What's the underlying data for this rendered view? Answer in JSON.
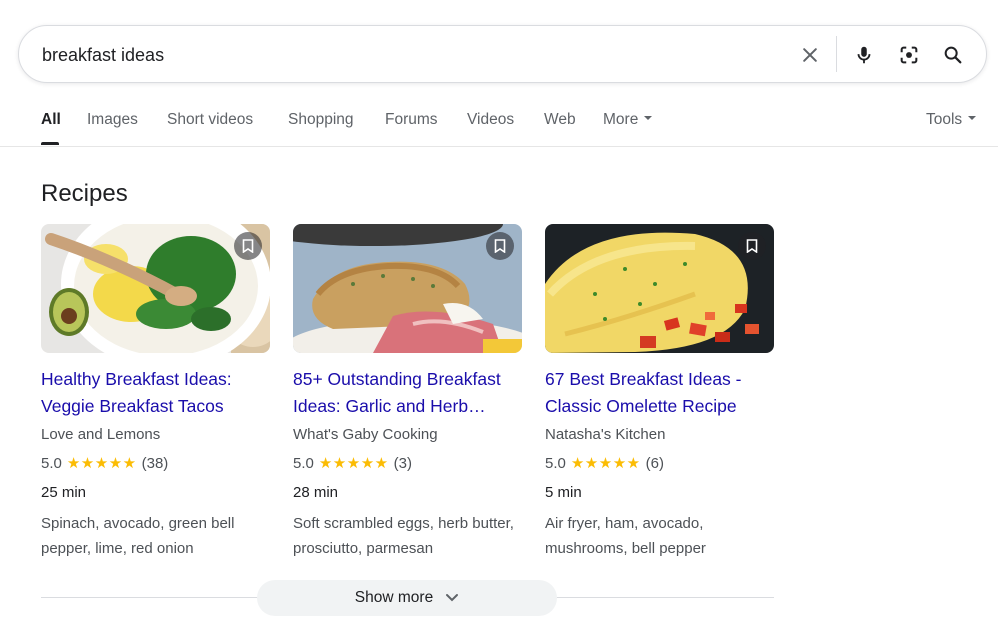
{
  "search": {
    "query": "breakfast ideas",
    "icons": [
      "close-icon",
      "microphone-icon",
      "lens-icon",
      "search-icon"
    ]
  },
  "tabs": [
    {
      "label": "All",
      "active": true
    },
    {
      "label": "Images"
    },
    {
      "label": "Short videos"
    },
    {
      "label": "Shopping"
    },
    {
      "label": "Forums"
    },
    {
      "label": "Videos"
    },
    {
      "label": "Web"
    },
    {
      "label": "More"
    }
  ],
  "tools_label": "Tools",
  "section": {
    "title": "Recipes"
  },
  "recipes": [
    {
      "title": "Healthy Breakfast Ideas: Veggie Breakfast Tacos",
      "source": "Love and Lemons",
      "rating": "5.0",
      "stars": "★★★★★",
      "reviews": "(38)",
      "time": "25 min",
      "ingredients": "Spinach, avocado, green bell pepper, lime, red onion"
    },
    {
      "title": "85+ Outstanding Breakfast Ideas: Garlic and Herb…",
      "source": "What's Gaby Cooking",
      "rating": "5.0",
      "stars": "★★★★★",
      "reviews": "(3)",
      "time": "28 min",
      "ingredients": "Soft scrambled eggs, herb butter, prosciutto, parmesan"
    },
    {
      "title": "67 Best Breakfast Ideas - Classic Omelette Recipe",
      "source": "Natasha's Kitchen",
      "rating": "5.0",
      "stars": "★★★★★",
      "reviews": "(6)",
      "time": "5 min",
      "ingredients": "Air fryer, ham, avocado, mushrooms, bell pepper"
    }
  ],
  "show_more_label": "Show more",
  "colors": {
    "link": "#1a0dab",
    "star": "#fbbc04",
    "secondary_text": "#4d5156"
  }
}
